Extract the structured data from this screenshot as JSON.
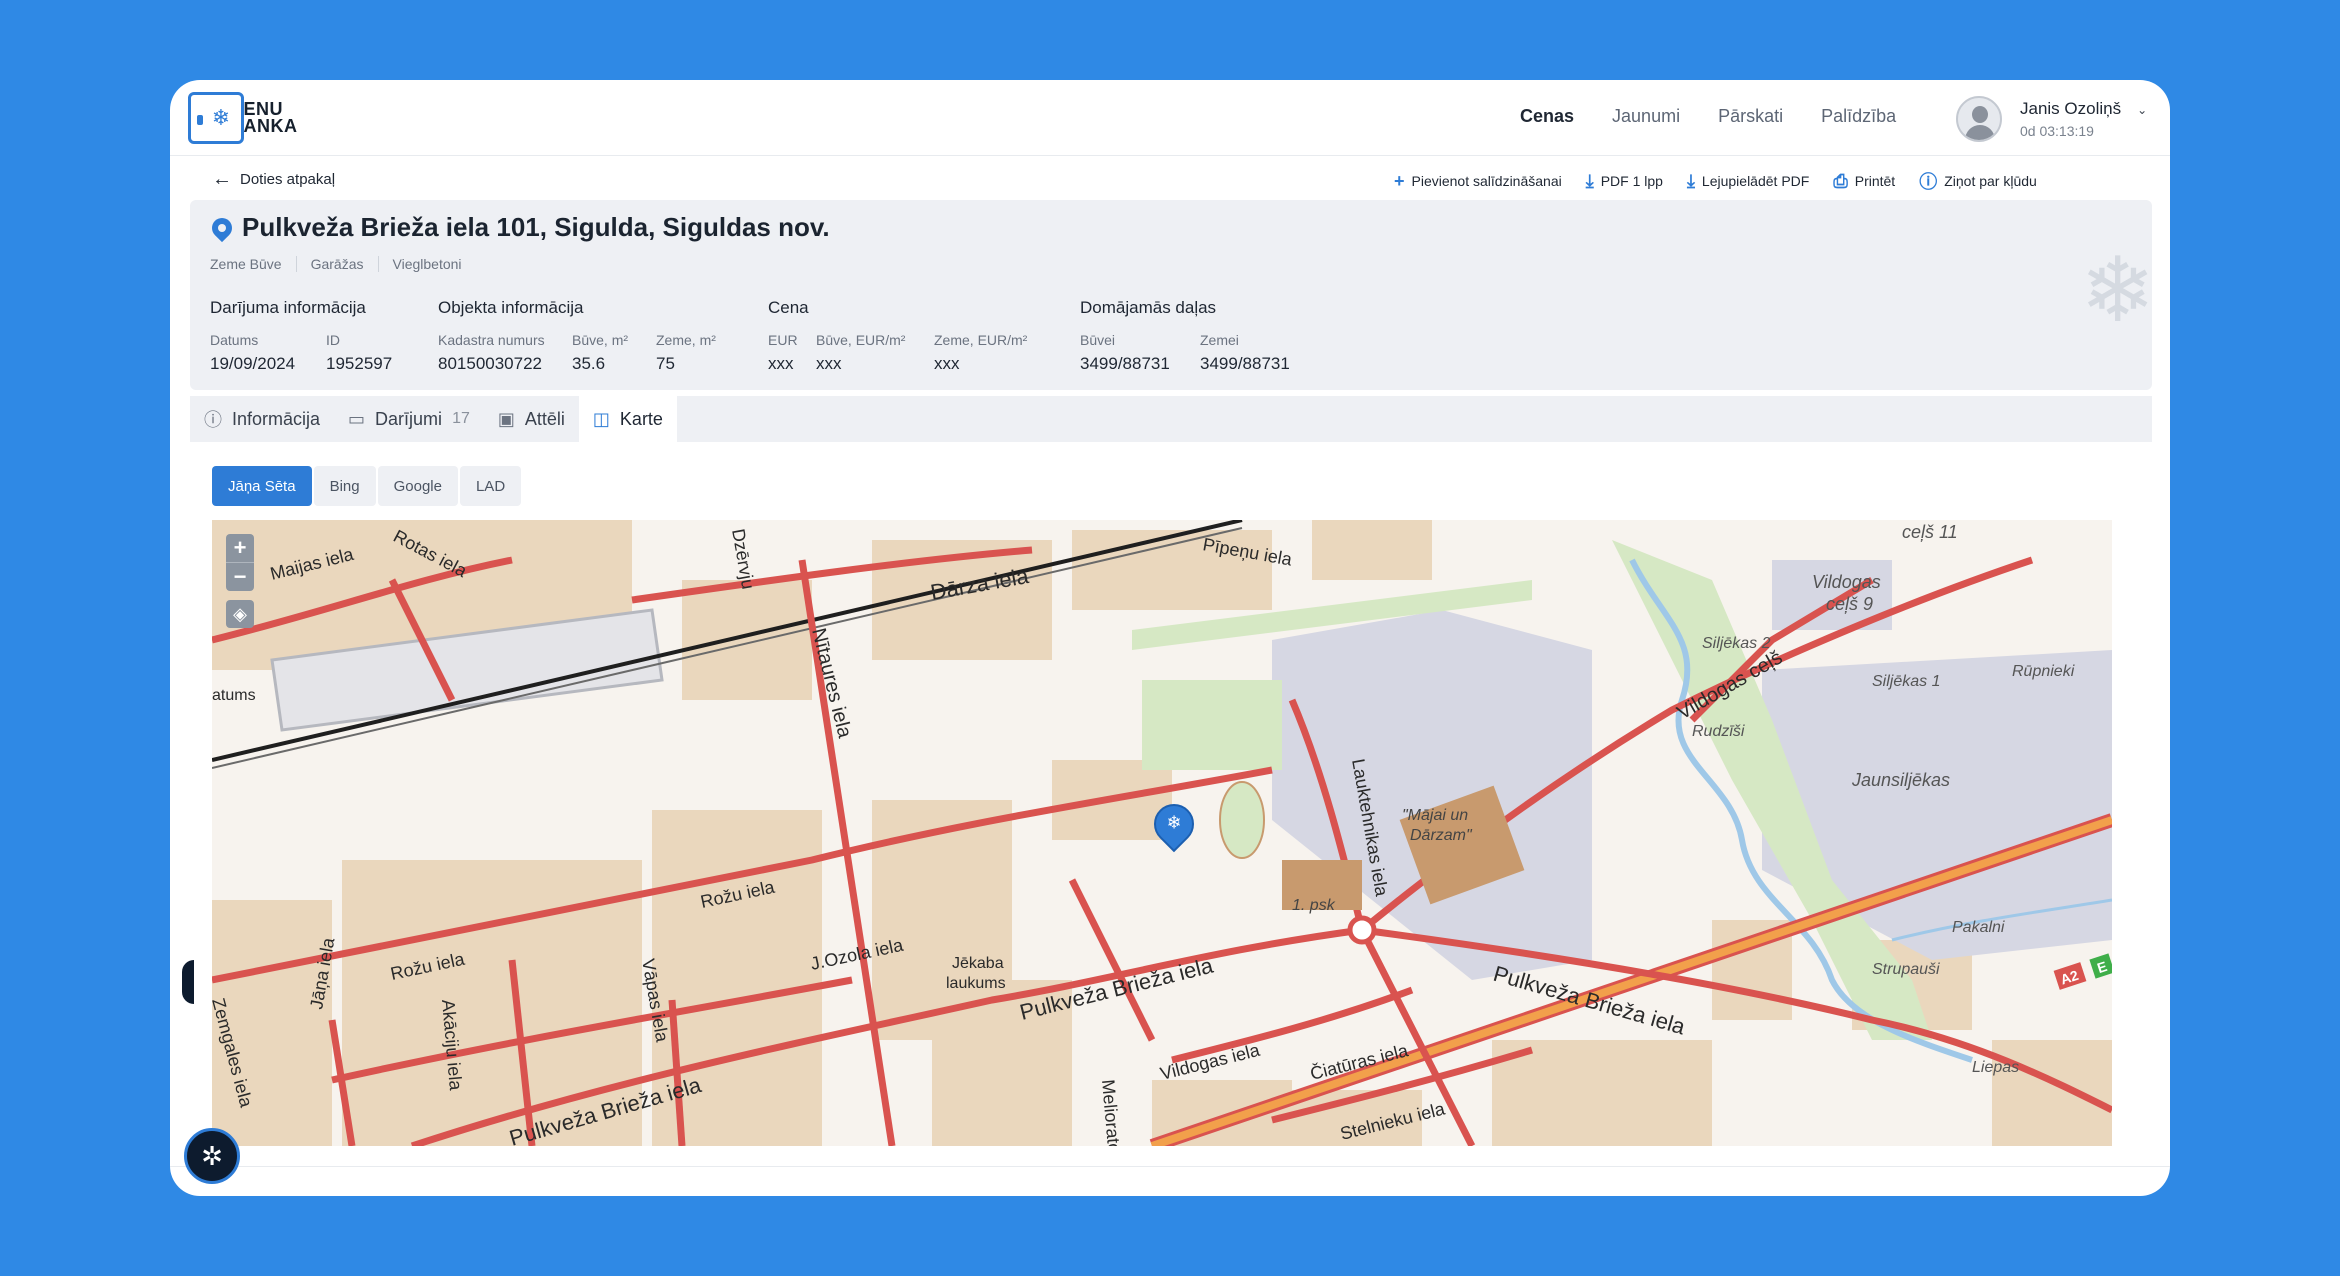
{
  "logo": {
    "line1": "CENU",
    "line2": "BANKA"
  },
  "nav": {
    "items": [
      "Cenas",
      "Jaunumi",
      "Pārskati",
      "Palīdzība"
    ],
    "active": "Cenas"
  },
  "user": {
    "name": "Janis Ozoliņš",
    "time": "0d 03:13:19"
  },
  "back_label": "Doties atpakaļ",
  "actions": {
    "compare": "Pievienot salīdzināšanai",
    "pdf1": "PDF 1 lpp",
    "download_pdf": "Lejupielādēt PDF",
    "print": "Printēt",
    "report": "Ziņot par kļūdu"
  },
  "property": {
    "address": "Pulkveža Brieža iela 101, Sigulda, Siguldas nov.",
    "tags": [
      "Zeme Būve",
      "Garāžas",
      "Vieglbetoni"
    ]
  },
  "groups": {
    "deal": {
      "heading": "Darījuma informācija",
      "date_label": "Datums",
      "date": "19/09/2024",
      "id_label": "ID",
      "id": "1952597"
    },
    "object": {
      "heading": "Objekta informācija",
      "cadastre_label": "Kadastra numurs",
      "cadastre": "80150030722",
      "building_label": "Būve, m²",
      "building": "35.6",
      "land_label": "Zeme, m²",
      "land": "75"
    },
    "price": {
      "heading": "Cena",
      "eur_label": "EUR",
      "eur": "xxx",
      "bldg_eur_label": "Būve, EUR/m²",
      "bldg_eur": "xxx",
      "land_eur_label": "Zeme, EUR/m²",
      "land_eur": "xxx"
    },
    "shares": {
      "heading": "Domājamās daļas",
      "bldg_label": "Būvei",
      "bldg": "3499/88731",
      "land_label": "Zemei",
      "land": "3499/88731"
    }
  },
  "tabs": {
    "info": "Informācija",
    "deals": "Darījumi",
    "deals_count": "17",
    "images": "Attēli",
    "map": "Karte",
    "active": "Karte"
  },
  "map_sources": {
    "items": [
      "Jāņa Sēta",
      "Bing",
      "Google",
      "LAD"
    ],
    "active": "Jāņa Sēta"
  },
  "map": {
    "labels": {
      "maijas": "Maijas iela",
      "rotas": "Rotas iela",
      "darza": "Dārza iela",
      "pipenu": "Pīpeņu iela",
      "nitaures": "Nītaures iela",
      "dzervju": "Dzērvju",
      "celjs11": "ceļš 11",
      "vildogas9": "Vildogas",
      "vildogas9b": "ceļš 9",
      "siljekas2": "Siljēkas 2",
      "siljekas1": "Siljēkas 1",
      "rupnieki": "Rūpnieki",
      "vildogas_celjs": "Vildogas ceļš",
      "rudzisi": "Rudzīši",
      "jaunsiljekas": "Jaunsiljēkas",
      "laukt": "Lauktehnikas iela",
      "majai1": "\"Mājai un",
      "majai2": "Dārzam\"",
      "psk": "1. psk",
      "datums": "atums",
      "rozu1": "Rožu iela",
      "rozu2": "Rožu iela",
      "jozola": "J.Ozola iela",
      "vapas": "Vāpas iela",
      "akaciju": "Akāciju iela",
      "janu": "Jāņa iela",
      "zemgales": "Zemgales iela",
      "jekaba1": "Jēkaba",
      "jekaba2": "laukums",
      "pb1": "Pulkveža Brieža iela",
      "pb2": "Pulkveža Brieža iela",
      "pb3": "Pulkveža Brieža iela",
      "vildogas_iela": "Vildogas iela",
      "ciatu": "Čiatūras iela",
      "melioratoru": "Melioratoru",
      "stelnieku": "Stelnieku iela",
      "pakalni": "Pakalni",
      "strupausi": "Strupauši",
      "liepas": "Liepas",
      "a2": "A2",
      "e": "E"
    }
  },
  "colors": {
    "accent": "#2E7CD6",
    "page_bg": "#2F89E5",
    "road": "#D9534F",
    "building": "#E9D5BA"
  }
}
